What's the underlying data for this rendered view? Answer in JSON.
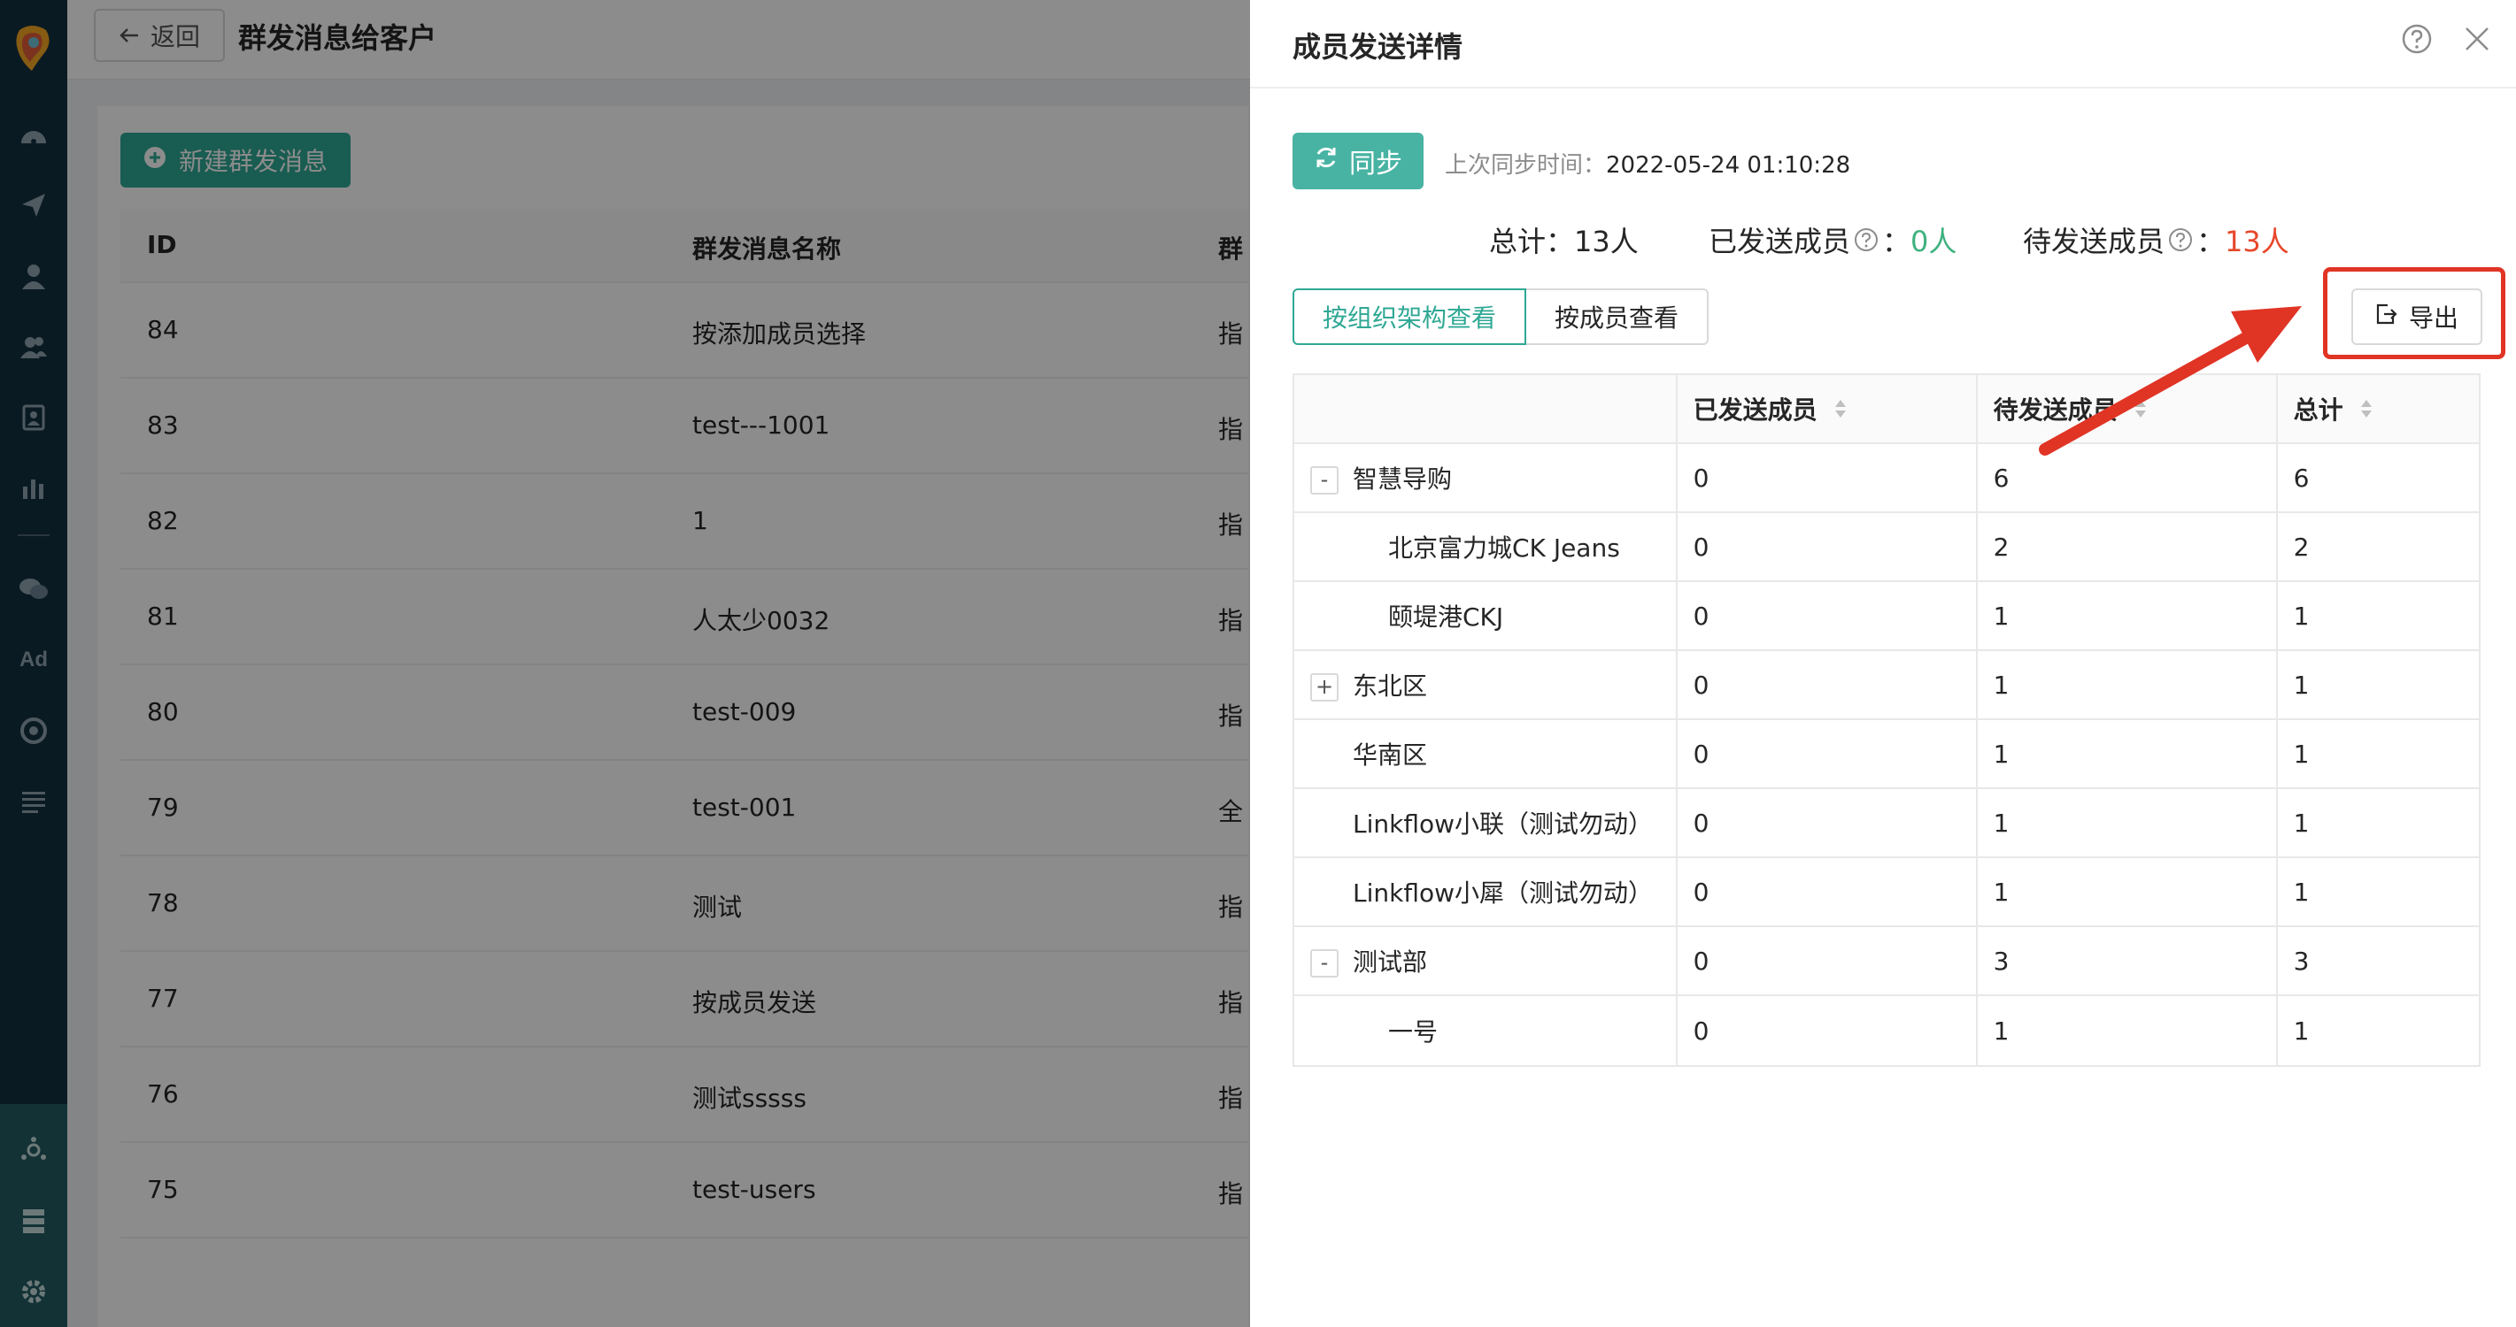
{
  "sidebar": {
    "icons": [
      "logo-icon",
      "dashboard-icon",
      "send-icon",
      "user-icon",
      "users-icon",
      "contact-card-icon",
      "bar-chart-icon",
      "wechat-icon",
      "ad-icon",
      "target-icon",
      "list-icon",
      "hub-icon",
      "server-icon",
      "gear-icon"
    ],
    "ad_label": "Ad"
  },
  "page": {
    "back_label": "返回",
    "title": "群发消息给客户",
    "new_button": "新建群发消息",
    "columns": [
      "ID",
      "群发消息名称",
      "群"
    ],
    "rows": [
      {
        "id": "84",
        "name": "按添加成员选择",
        "extra": "指"
      },
      {
        "id": "83",
        "name": "test---1001",
        "extra": "指"
      },
      {
        "id": "82",
        "name": "1",
        "extra": "指"
      },
      {
        "id": "81",
        "name": "人太少0032",
        "extra": "指"
      },
      {
        "id": "80",
        "name": "test-009",
        "extra": "指"
      },
      {
        "id": "79",
        "name": "test-001",
        "extra": "全"
      },
      {
        "id": "78",
        "name": "测试",
        "extra": "指"
      },
      {
        "id": "77",
        "name": "按成员发送",
        "extra": "指"
      },
      {
        "id": "76",
        "name": "测试sssss",
        "extra": "指"
      },
      {
        "id": "75",
        "name": "test-users",
        "extra": "指"
      }
    ]
  },
  "drawer": {
    "title": "成员发送详情",
    "sync_button": "同步",
    "sync_time_label": "上次同步时间：",
    "sync_time_value": "2022-05-24 01:10:28",
    "stats": {
      "total_label": "总计：",
      "total_value": "13人",
      "sent_label": "已发送成员",
      "sent_value": "0人",
      "pending_label": "待发送成员",
      "pending_value": "13人",
      "colon": "："
    },
    "view_tabs": [
      "按组织架构查看",
      "按成员查看"
    ],
    "active_tab": "按组织架构查看",
    "export_button": "导出",
    "table": {
      "headers": [
        "",
        "已发送成员",
        "待发送成员",
        "总计"
      ],
      "rows": [
        {
          "name": "智慧导购",
          "level": 0,
          "toggle": "-",
          "sent": "0",
          "pending": "6",
          "total": "6"
        },
        {
          "name": "北京富力城CK Jeans",
          "level": 1,
          "toggle": "",
          "sent": "0",
          "pending": "2",
          "total": "2"
        },
        {
          "name": "颐堤港CKJ",
          "level": 1,
          "toggle": "",
          "sent": "0",
          "pending": "1",
          "total": "1"
        },
        {
          "name": "东北区",
          "level": 0,
          "toggle": "+",
          "sent": "0",
          "pending": "1",
          "total": "1"
        },
        {
          "name": "华南区",
          "level": 0,
          "toggle": "",
          "sent": "0",
          "pending": "1",
          "total": "1"
        },
        {
          "name": "Linkflow小联（测试勿动）",
          "level": 0,
          "toggle": "",
          "sent": "0",
          "pending": "1",
          "total": "1"
        },
        {
          "name": "Linkflow小犀（测试勿动）",
          "level": 0,
          "toggle": "",
          "sent": "0",
          "pending": "1",
          "total": "1"
        },
        {
          "name": "测试部",
          "level": 0,
          "toggle": "-",
          "sent": "0",
          "pending": "3",
          "total": "3"
        },
        {
          "name": "一号",
          "level": 1,
          "toggle": "",
          "sent": "0",
          "pending": "1",
          "total": "1"
        }
      ]
    }
  },
  "colors": {
    "sidebar": "#13303e",
    "primary": "#2fa894",
    "sent": "#3fb27f",
    "pending": "#e8472b",
    "annotation": "#e03425"
  }
}
